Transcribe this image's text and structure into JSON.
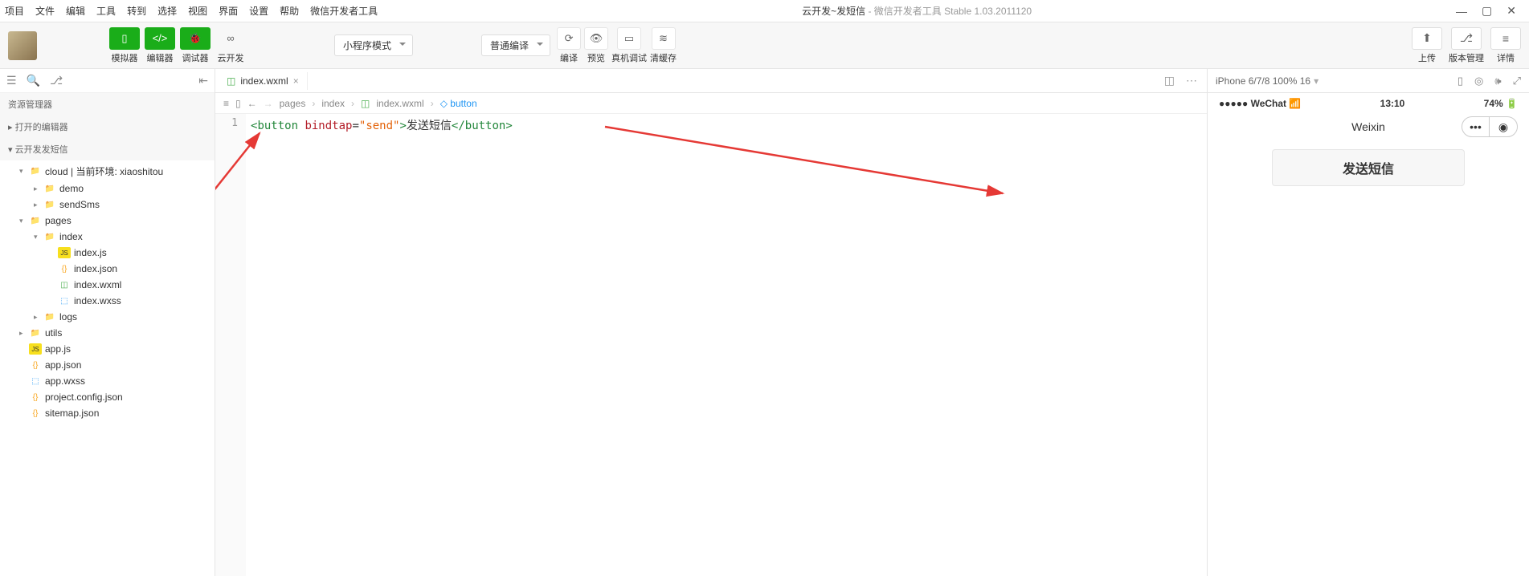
{
  "menubar": [
    "项目",
    "文件",
    "编辑",
    "工具",
    "转到",
    "选择",
    "视图",
    "界面",
    "设置",
    "帮助",
    "微信开发者工具"
  ],
  "title": {
    "main": "云开发~发短信",
    "sub": " - 微信开发者工具 Stable 1.03.2011120"
  },
  "toolbar": {
    "simulator": "模拟器",
    "editor": "编辑器",
    "debugger": "调试器",
    "cloud": "云开发",
    "mode_dropdown": "小程序模式",
    "compile_dropdown": "普通编译",
    "compile": "编译",
    "preview": "预览",
    "debug": "真机调试",
    "clear": "清缓存",
    "upload": "上传",
    "version": "版本管理",
    "details": "详情"
  },
  "sidebar": {
    "explorer": "资源管理器",
    "open_editors": "打开的编辑器",
    "project_name": "云开发发短信",
    "tree": [
      {
        "level": 1,
        "arrow": "▾",
        "iconClass": "folder-ic",
        "icon": "📁",
        "label": "cloud | 当前环境: xiaoshitou"
      },
      {
        "level": 2,
        "arrow": "▸",
        "iconClass": "folder-ic gray",
        "icon": "📁",
        "label": "demo"
      },
      {
        "level": 2,
        "arrow": "▸",
        "iconClass": "folder-ic gray",
        "icon": "📁",
        "label": "sendSms"
      },
      {
        "level": 1,
        "arrow": "▾",
        "iconClass": "folder-ic",
        "icon": "📁",
        "label": "pages"
      },
      {
        "level": 2,
        "arrow": "▾",
        "iconClass": "folder-ic gray",
        "icon": "📁",
        "label": "index"
      },
      {
        "level": 3,
        "arrow": "",
        "iconClass": "js-ic",
        "icon": "JS",
        "label": "index.js"
      },
      {
        "level": 3,
        "arrow": "",
        "iconClass": "json-ic",
        "icon": "{}",
        "label": "index.json"
      },
      {
        "level": 3,
        "arrow": "",
        "iconClass": "wxml-ic",
        "icon": "◫",
        "label": "index.wxml"
      },
      {
        "level": 3,
        "arrow": "",
        "iconClass": "wxss-ic",
        "icon": "⬚",
        "label": "index.wxss"
      },
      {
        "level": 2,
        "arrow": "▸",
        "iconClass": "folder-ic green",
        "icon": "📁",
        "label": "logs"
      },
      {
        "level": 1,
        "arrow": "▸",
        "iconClass": "folder-ic green",
        "icon": "📁",
        "label": "utils"
      },
      {
        "level": 1,
        "arrow": "",
        "iconClass": "js-ic",
        "icon": "JS",
        "label": "app.js"
      },
      {
        "level": 1,
        "arrow": "",
        "iconClass": "json-ic",
        "icon": "{}",
        "label": "app.json"
      },
      {
        "level": 1,
        "arrow": "",
        "iconClass": "wxss-ic",
        "icon": "⬚",
        "label": "app.wxss"
      },
      {
        "level": 1,
        "arrow": "",
        "iconClass": "json-ic",
        "icon": "{}",
        "label": "project.config.json"
      },
      {
        "level": 1,
        "arrow": "",
        "iconClass": "json-ic",
        "icon": "{}",
        "label": "sitemap.json"
      }
    ]
  },
  "editor": {
    "tab_file": "index.wxml",
    "breadcrumb": [
      "pages",
      "index",
      "index.wxml",
      "button"
    ],
    "line_number": "1",
    "code": {
      "open_angle": "<",
      "button_tag": "button",
      "attr_name": " bindtap",
      "equals": "=",
      "attr_val": "\"send\"",
      "close_angle": ">",
      "text": "发送短信",
      "close_open": "</",
      "close_tag": "button",
      "final": ">"
    }
  },
  "simulator": {
    "device": "iPhone 6/7/8 100% 16",
    "signal": "●●●●●",
    "carrier": " WeChat",
    "time": "13:10",
    "battery_pct": "74%",
    "nav_title": "Weixin",
    "button_text": "发送短信"
  }
}
